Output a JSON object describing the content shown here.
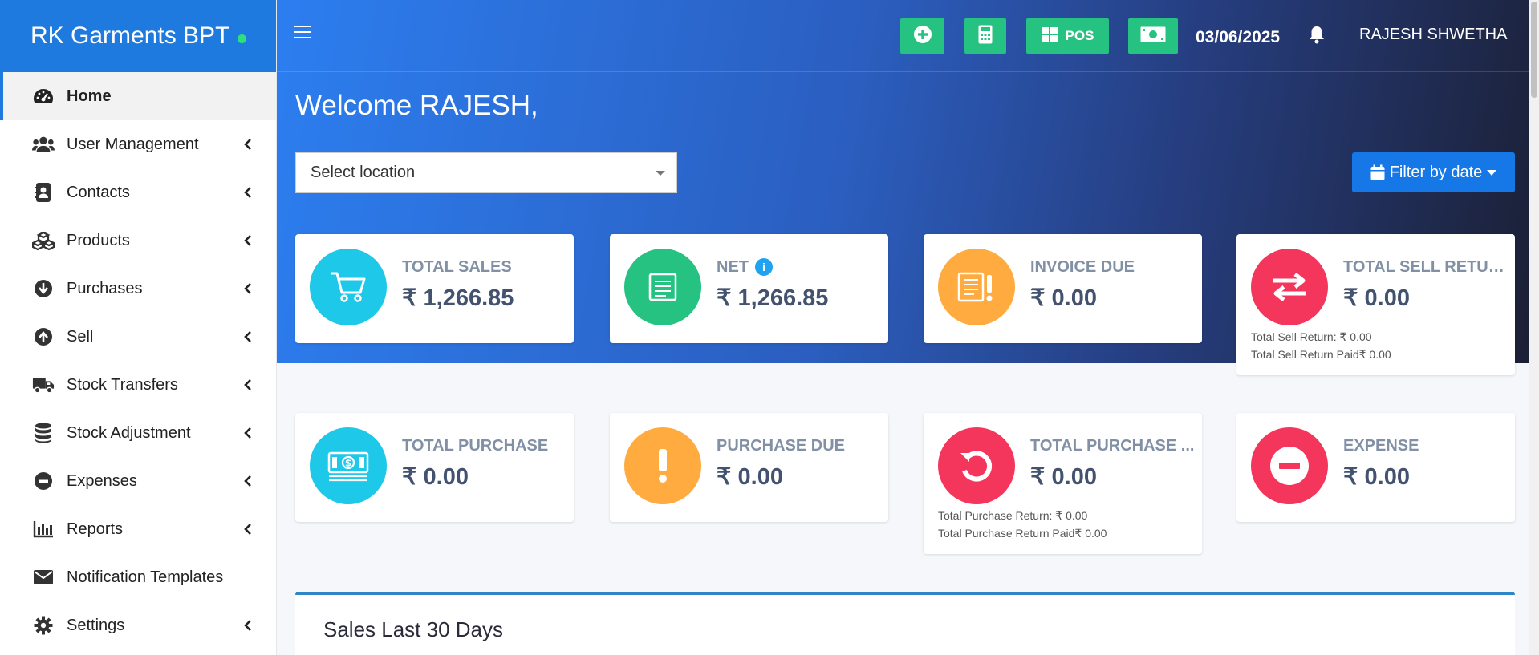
{
  "brand": {
    "name": "RK Garments BPT"
  },
  "sidebar": {
    "items": [
      {
        "label": "Home",
        "icon": "dashboard-icon",
        "active": true
      },
      {
        "label": "User Management",
        "icon": "users-icon"
      },
      {
        "label": "Contacts",
        "icon": "contact-book-icon"
      },
      {
        "label": "Products",
        "icon": "cubes-icon"
      },
      {
        "label": "Purchases",
        "icon": "arrow-circle-down-icon"
      },
      {
        "label": "Sell",
        "icon": "arrow-circle-up-icon"
      },
      {
        "label": "Stock Transfers",
        "icon": "truck-icon"
      },
      {
        "label": "Stock Adjustment",
        "icon": "database-icon"
      },
      {
        "label": "Expenses",
        "icon": "minus-circle-icon"
      },
      {
        "label": "Reports",
        "icon": "bar-chart-icon"
      },
      {
        "label": "Notification Templates",
        "icon": "envelope-icon"
      },
      {
        "label": "Settings",
        "icon": "gear-icon"
      }
    ]
  },
  "topbar": {
    "pos_label": "POS",
    "date": "03/06/2025",
    "user": "RAJESH SHWETHA",
    "colors": {
      "button": "#26c281"
    }
  },
  "main": {
    "welcome": "Welcome RAJESH,",
    "location_placeholder": "Select location",
    "filter_label": "Filter by date"
  },
  "cards": {
    "total_sales": {
      "title": "TOTAL SALES",
      "value": "₹ 1,266.85",
      "color": "#1ec8e8"
    },
    "net": {
      "title": "NET",
      "value": "₹ 1,266.85",
      "color": "#26c281",
      "info": "i"
    },
    "invoice_due": {
      "title": "INVOICE DUE",
      "value": "₹ 0.00",
      "color": "#ffab40"
    },
    "total_sell_return": {
      "title": "TOTAL SELL RETURN",
      "value": "₹ 0.00",
      "color": "#f5365c",
      "sub1": "Total Sell Return: ₹ 0.00",
      "sub2": "Total Sell Return Paid₹ 0.00"
    },
    "total_purchase": {
      "title": "TOTAL PURCHASE",
      "value": "₹ 0.00",
      "color": "#1ec8e8"
    },
    "purchase_due": {
      "title": "PURCHASE DUE",
      "value": "₹ 0.00",
      "color": "#ffab40"
    },
    "total_purchase_return": {
      "title": "TOTAL PURCHASE ...",
      "value": "₹ 0.00",
      "color": "#f5365c",
      "sub1": "Total Purchase Return: ₹ 0.00",
      "sub2": "Total Purchase Return Paid₹ 0.00"
    },
    "expense": {
      "title": "EXPENSE",
      "value": "₹ 0.00",
      "color": "#f5365c"
    }
  },
  "panel": {
    "title": "Sales Last 30 Days"
  }
}
